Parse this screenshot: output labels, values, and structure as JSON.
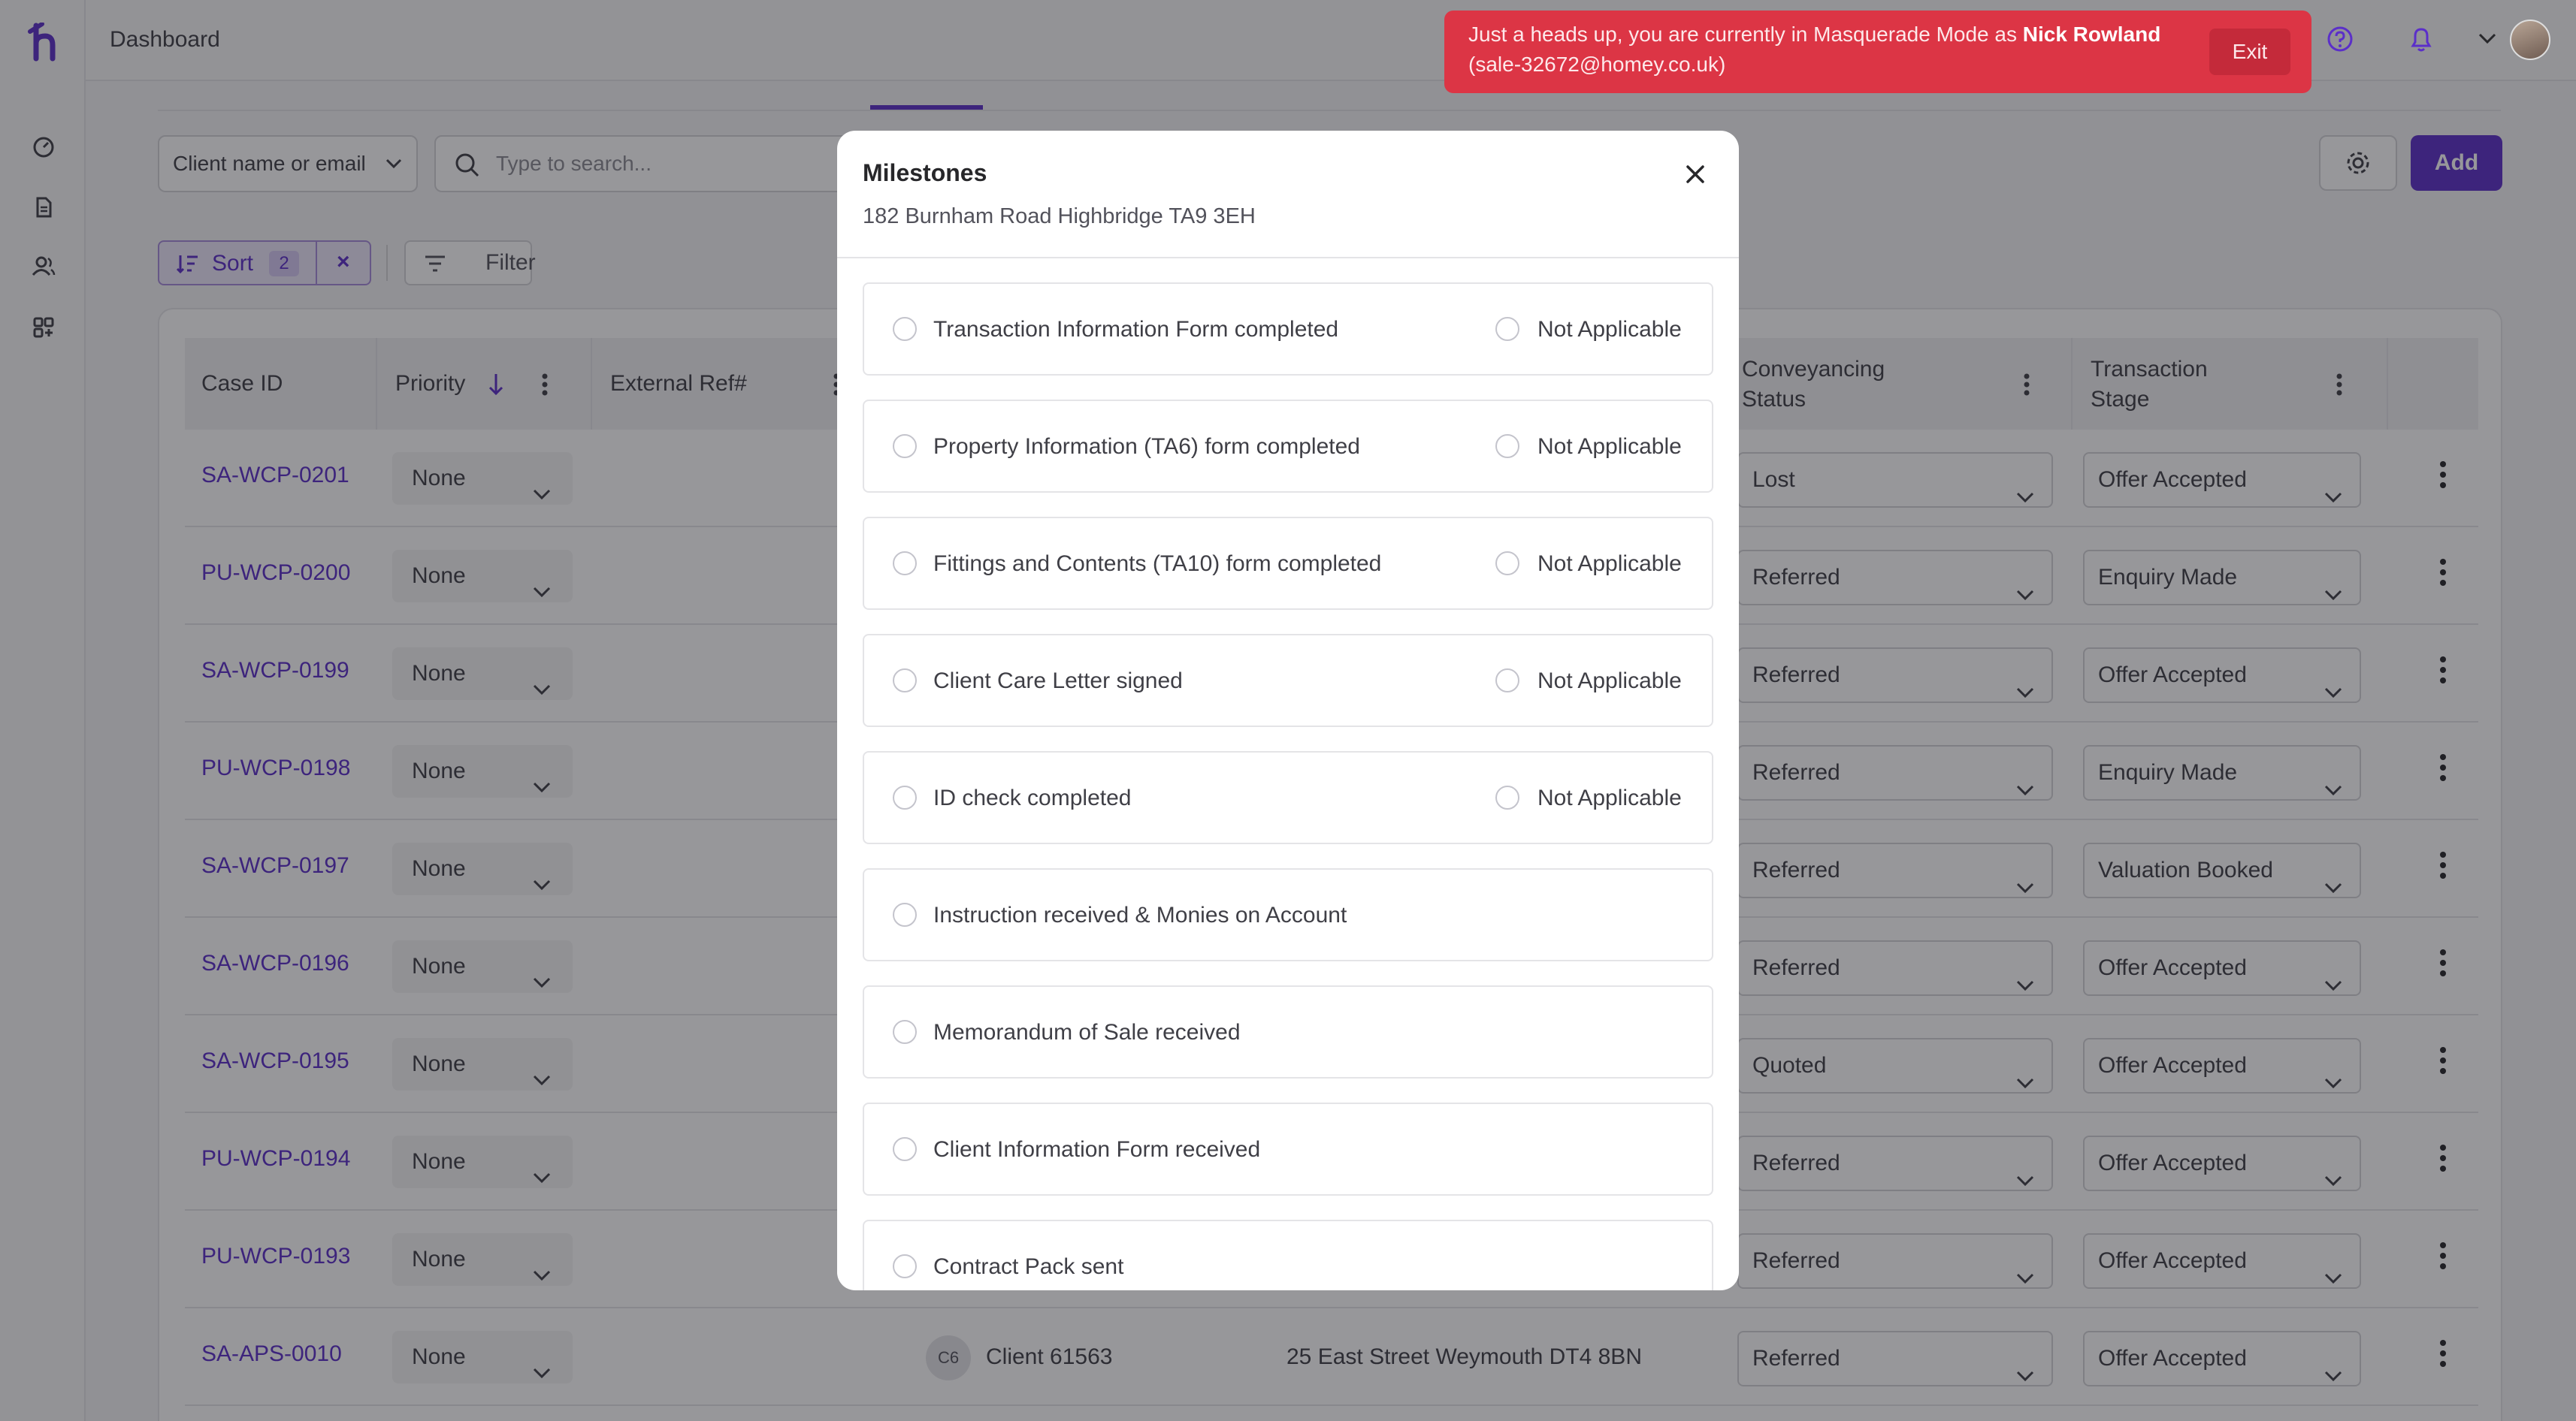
{
  "topbar": {
    "breadcrumb": "Dashboard",
    "banner_text": "Just a heads up, you are currently in Masquerade Mode as ",
    "banner_name": "Nick Rowland",
    "banner_email": "(sale-32672@homey.co.uk)",
    "banner_exit": "Exit"
  },
  "toolbar": {
    "client_select": "Client name or email",
    "search_placeholder": "Type to search...",
    "add_label": "Add",
    "sort_label": "Sort",
    "sort_count": "2",
    "filter_label": "Filter"
  },
  "table": {
    "headers": {
      "case_id": "Case ID",
      "priority": "Priority",
      "external_ref": "External Ref#",
      "conveyancing_1": "Conveyancing",
      "conveyancing_2": "Status",
      "transaction_1": "Transaction",
      "transaction_2": "Stage"
    },
    "rows": [
      {
        "id": "SA-WCP-0201",
        "priority": "None",
        "conveyancing": "Lost",
        "stage": "Offer Accepted"
      },
      {
        "id": "PU-WCP-0200",
        "priority": "None",
        "conveyancing": "Referred",
        "stage": "Enquiry Made"
      },
      {
        "id": "SA-WCP-0199",
        "priority": "None",
        "conveyancing": "Referred",
        "stage": "Offer Accepted"
      },
      {
        "id": "PU-WCP-0198",
        "priority": "None",
        "conveyancing": "Referred",
        "stage": "Enquiry Made"
      },
      {
        "id": "SA-WCP-0197",
        "priority": "None",
        "conveyancing": "Referred",
        "stage": "Valuation Booked"
      },
      {
        "id": "SA-WCP-0196",
        "priority": "None",
        "conveyancing": "Referred",
        "stage": "Offer Accepted"
      },
      {
        "id": "SA-WCP-0195",
        "priority": "None",
        "conveyancing": "Quoted",
        "stage": "Offer Accepted"
      },
      {
        "id": "PU-WCP-0194",
        "priority": "None",
        "conveyancing": "Referred",
        "stage": "Offer Accepted"
      },
      {
        "id": "PU-WCP-0193",
        "priority": "None",
        "conveyancing": "Referred",
        "stage": "Offer Accepted"
      },
      {
        "id": "SA-APS-0010",
        "priority": "None",
        "conveyancing": "Referred",
        "stage": "Offer Accepted",
        "client_badge": "C6",
        "client_name": "Client 61563",
        "address": "25 East Street Weymouth DT4 8BN"
      }
    ]
  },
  "modal": {
    "title": "Milestones",
    "address": "182 Burnham Road Highbridge TA9 3EH",
    "not_applicable": "Not Applicable",
    "milestones": [
      {
        "label": "Transaction Information Form completed",
        "has_na": true
      },
      {
        "label": "Property Information (TA6) form completed",
        "has_na": true
      },
      {
        "label": "Fittings and Contents (TA10) form completed",
        "has_na": true
      },
      {
        "label": "Client Care Letter signed",
        "has_na": true
      },
      {
        "label": "ID check completed",
        "has_na": true
      },
      {
        "label": "Instruction received & Monies on Account",
        "has_na": false
      },
      {
        "label": "Memorandum of Sale received",
        "has_na": false
      },
      {
        "label": "Client Information Form received",
        "has_na": false
      },
      {
        "label": "Contract Pack sent",
        "has_na": false
      }
    ]
  },
  "colors": {
    "accent": "#5b2fc9",
    "banner": "#dc3545"
  }
}
